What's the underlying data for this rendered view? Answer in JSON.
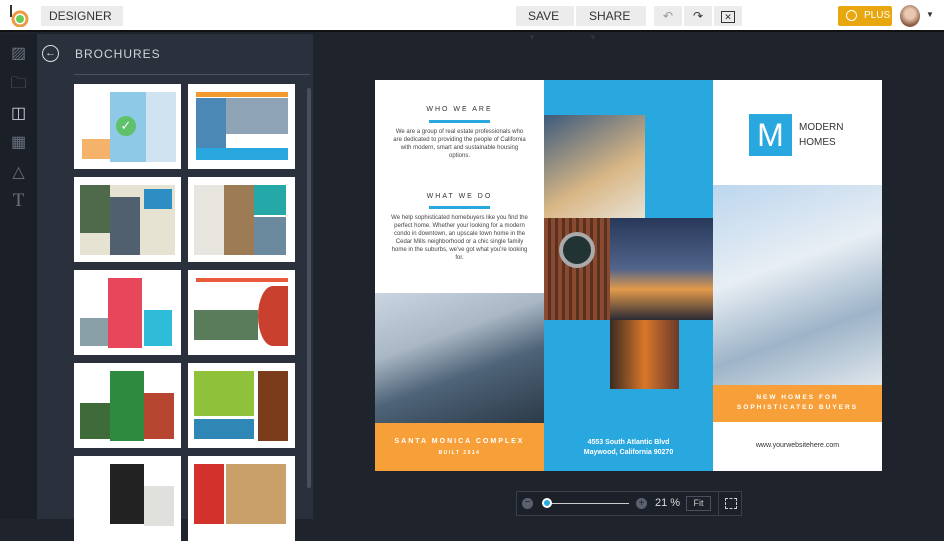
{
  "topbar": {
    "mode": "DESIGNER",
    "save": "SAVE",
    "share": "SHARE",
    "plus": "PLUS"
  },
  "panel": {
    "title": "BROCHURES"
  },
  "brochure": {
    "who_heading": "WHO WE ARE",
    "who_text": "We are a group of real estate professionals who are dedicated to providing the people of California with modern, smart and sustainable housing options.",
    "what_heading": "WHAT WE DO",
    "what_text": "We help sophisticated homebuyers like you find the perfect home. Whether your looking for a modern condo in downtown, an upscale town home in the Cedar Mills neighborhood or a chic single family home in the suburbs, we've got what you're looking for.",
    "complex_title": "SANTA MONICA COMPLEX",
    "complex_sub": "BUILT 2014",
    "address1": "4553 South Atlantic Blvd",
    "address2": "Maywood, California 90270",
    "logo_letter": "M",
    "brand1": "MODERN",
    "brand2": "HOMES",
    "tag1": "NEW HOMES FOR",
    "tag2": "SOPHISTICATED BUYERS",
    "website": "www.yourwebsitehere.com"
  },
  "zoom": {
    "value": "21 %",
    "percent": 21,
    "fit": "Fit"
  },
  "colors": {
    "accent": "#29a7df",
    "orange": "#f7a03a",
    "plus": "#e8a70f"
  }
}
